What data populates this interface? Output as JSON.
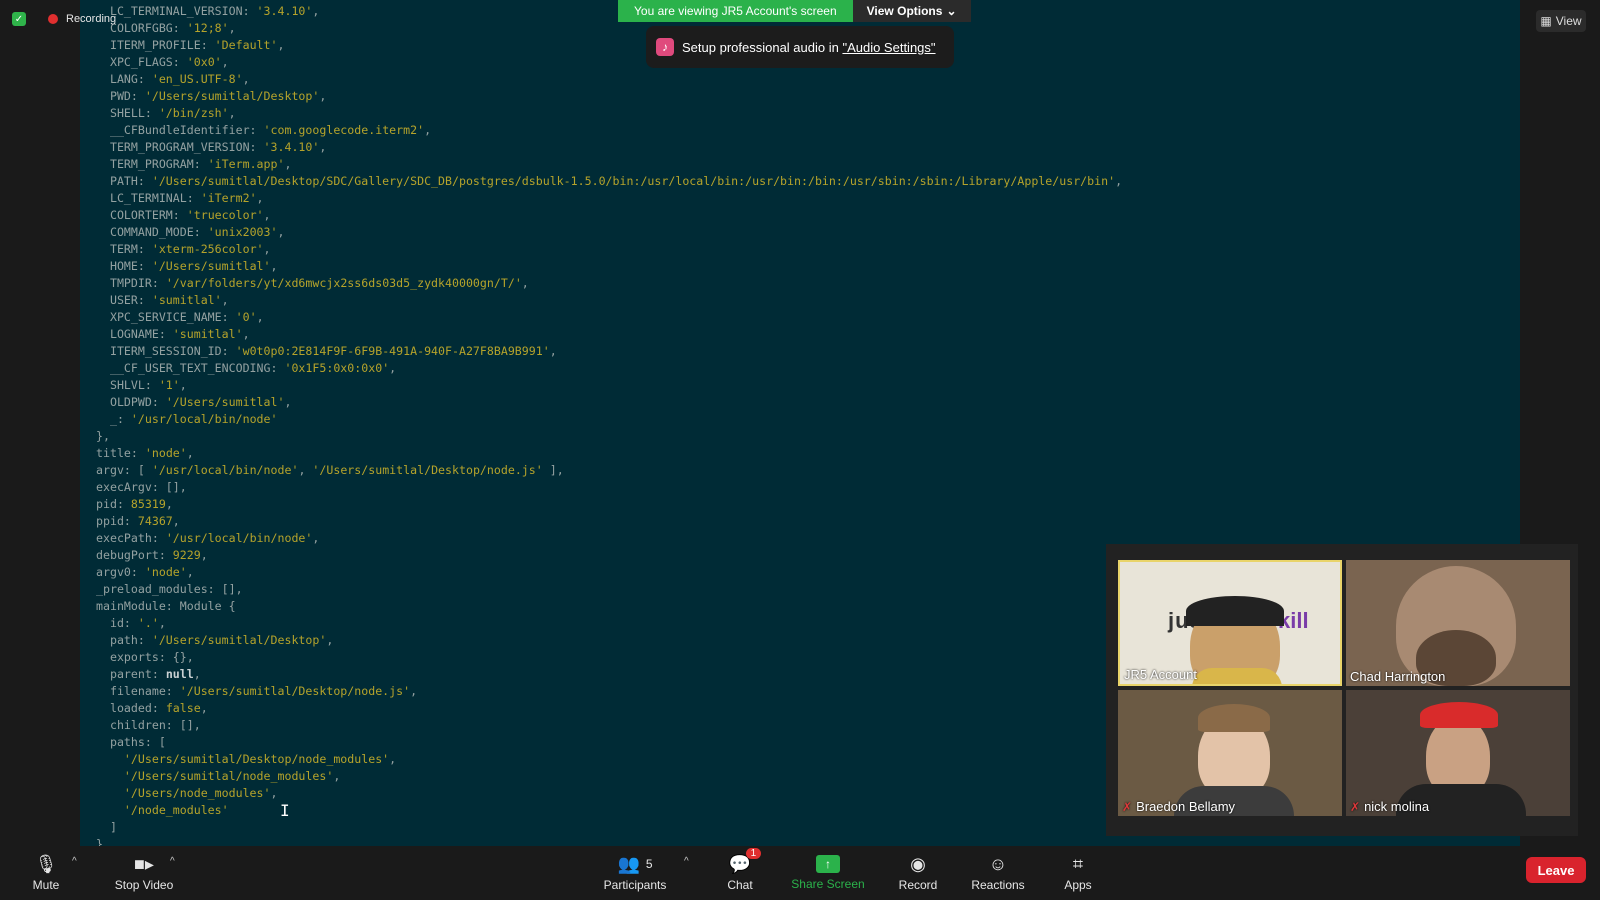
{
  "recording": {
    "label": "Recording"
  },
  "sharing": {
    "message": "You are viewing JR5 Account's screen",
    "options": "View Options"
  },
  "notification": {
    "text_prefix": "Setup professional audio in ",
    "link": "\"Audio Settings\""
  },
  "view_button": {
    "label": "View"
  },
  "terminal": {
    "lines": [
      [
        [
          "k",
          "  LC_TERMINAL_VERSION: "
        ],
        [
          "s",
          "'3.4.10'"
        ],
        [
          "k",
          ","
        ]
      ],
      [
        [
          "k",
          "  COLORFGBG: "
        ],
        [
          "s",
          "'12;8'"
        ],
        [
          "k",
          ","
        ]
      ],
      [
        [
          "k",
          "  ITERM_PROFILE: "
        ],
        [
          "s",
          "'Default'"
        ],
        [
          "k",
          ","
        ]
      ],
      [
        [
          "k",
          "  XPC_FLAGS: "
        ],
        [
          "s",
          "'0x0'"
        ],
        [
          "k",
          ","
        ]
      ],
      [
        [
          "k",
          "  LANG: "
        ],
        [
          "s",
          "'en_US.UTF-8'"
        ],
        [
          "k",
          ","
        ]
      ],
      [
        [
          "k",
          "  PWD: "
        ],
        [
          "s",
          "'/Users/sumitlal/Desktop'"
        ],
        [
          "k",
          ","
        ]
      ],
      [
        [
          "k",
          "  SHELL: "
        ],
        [
          "s",
          "'/bin/zsh'"
        ],
        [
          "k",
          ","
        ]
      ],
      [
        [
          "k",
          "  __CFBundleIdentifier: "
        ],
        [
          "s",
          "'com.googlecode.iterm2'"
        ],
        [
          "k",
          ","
        ]
      ],
      [
        [
          "k",
          "  TERM_PROGRAM_VERSION: "
        ],
        [
          "s",
          "'3.4.10'"
        ],
        [
          "k",
          ","
        ]
      ],
      [
        [
          "k",
          "  TERM_PROGRAM: "
        ],
        [
          "s",
          "'iTerm.app'"
        ],
        [
          "k",
          ","
        ]
      ],
      [
        [
          "k",
          "  PATH: "
        ],
        [
          "s",
          "'/Users/sumitlal/Desktop/SDC/Gallery/SDC_DB/postgres/dsbulk-1.5.0/bin:/usr/local/bin:/usr/bin:/bin:/usr/sbin:/sbin:/Library/Apple/usr/bin'"
        ],
        [
          "k",
          ","
        ]
      ],
      [
        [
          "k",
          "  LC_TERMINAL: "
        ],
        [
          "s",
          "'iTerm2'"
        ],
        [
          "k",
          ","
        ]
      ],
      [
        [
          "k",
          "  COLORTERM: "
        ],
        [
          "s",
          "'truecolor'"
        ],
        [
          "k",
          ","
        ]
      ],
      [
        [
          "k",
          "  COMMAND_MODE: "
        ],
        [
          "s",
          "'unix2003'"
        ],
        [
          "k",
          ","
        ]
      ],
      [
        [
          "k",
          "  TERM: "
        ],
        [
          "s",
          "'xterm-256color'"
        ],
        [
          "k",
          ","
        ]
      ],
      [
        [
          "k",
          "  HOME: "
        ],
        [
          "s",
          "'/Users/sumitlal'"
        ],
        [
          "k",
          ","
        ]
      ],
      [
        [
          "k",
          "  TMPDIR: "
        ],
        [
          "s",
          "'/var/folders/yt/xd6mwcjx2ss6ds03d5_zydk40000gn/T/'"
        ],
        [
          "k",
          ","
        ]
      ],
      [
        [
          "k",
          "  USER: "
        ],
        [
          "s",
          "'sumitlal'"
        ],
        [
          "k",
          ","
        ]
      ],
      [
        [
          "k",
          "  XPC_SERVICE_NAME: "
        ],
        [
          "s",
          "'0'"
        ],
        [
          "k",
          ","
        ]
      ],
      [
        [
          "k",
          "  LOGNAME: "
        ],
        [
          "s",
          "'sumitlal'"
        ],
        [
          "k",
          ","
        ]
      ],
      [
        [
          "k",
          "  ITERM_SESSION_ID: "
        ],
        [
          "s",
          "'w0t0p0:2E814F9F-6F9B-491A-940F-A27F8BA9B991'"
        ],
        [
          "k",
          ","
        ]
      ],
      [
        [
          "k",
          "  __CF_USER_TEXT_ENCODING: "
        ],
        [
          "s",
          "'0x1F5:0x0:0x0'"
        ],
        [
          "k",
          ","
        ]
      ],
      [
        [
          "k",
          "  SHLVL: "
        ],
        [
          "s",
          "'1'"
        ],
        [
          "k",
          ","
        ]
      ],
      [
        [
          "k",
          "  OLDPWD: "
        ],
        [
          "s",
          "'/Users/sumitlal'"
        ],
        [
          "k",
          ","
        ]
      ],
      [
        [
          "k",
          "  _: "
        ],
        [
          "s",
          "'/usr/local/bin/node'"
        ]
      ],
      [
        [
          "k",
          "},"
        ]
      ],
      [
        [
          "k",
          "title: "
        ],
        [
          "s",
          "'node'"
        ],
        [
          "k",
          ","
        ]
      ],
      [
        [
          "k",
          "argv: [ "
        ],
        [
          "s",
          "'/usr/local/bin/node'"
        ],
        [
          "k",
          ", "
        ],
        [
          "s",
          "'/Users/sumitlal/Desktop/node.js'"
        ],
        [
          "k",
          " ],"
        ]
      ],
      [
        [
          "k",
          "execArgv: [],"
        ]
      ],
      [
        [
          "k",
          "pid: "
        ],
        [
          "n",
          "85319"
        ],
        [
          "k",
          ","
        ]
      ],
      [
        [
          "k",
          "ppid: "
        ],
        [
          "n",
          "74367"
        ],
        [
          "k",
          ","
        ]
      ],
      [
        [
          "k",
          "execPath: "
        ],
        [
          "s",
          "'/usr/local/bin/node'"
        ],
        [
          "k",
          ","
        ]
      ],
      [
        [
          "k",
          "debugPort: "
        ],
        [
          "n",
          "9229"
        ],
        [
          "k",
          ","
        ]
      ],
      [
        [
          "k",
          "argv0: "
        ],
        [
          "s",
          "'node'"
        ],
        [
          "k",
          ","
        ]
      ],
      [
        [
          "k",
          "_preload_modules: [],"
        ]
      ],
      [
        [
          "k",
          "mainModule: Module {"
        ]
      ],
      [
        [
          "k",
          "  id: "
        ],
        [
          "s",
          "'.'"
        ],
        [
          "k",
          ","
        ]
      ],
      [
        [
          "k",
          "  path: "
        ],
        [
          "s",
          "'/Users/sumitlal/Desktop'"
        ],
        [
          "k",
          ","
        ]
      ],
      [
        [
          "k",
          "  exports: {},"
        ]
      ],
      [
        [
          "k",
          "  parent: "
        ],
        [
          "b",
          "null"
        ],
        [
          "k",
          ","
        ]
      ],
      [
        [
          "k",
          "  filename: "
        ],
        [
          "s",
          "'/Users/sumitlal/Desktop/node.js'"
        ],
        [
          "k",
          ","
        ]
      ],
      [
        [
          "k",
          "  loaded: "
        ],
        [
          "n",
          "false"
        ],
        [
          "k",
          ","
        ]
      ],
      [
        [
          "k",
          "  children: [],"
        ]
      ],
      [
        [
          "k",
          "  paths: ["
        ]
      ],
      [
        [
          "k",
          "    "
        ],
        [
          "s",
          "'/Users/sumitlal/Desktop/node_modules'"
        ],
        [
          "k",
          ","
        ]
      ],
      [
        [
          "k",
          "    "
        ],
        [
          "s",
          "'/Users/sumitlal/node_modules'"
        ],
        [
          "k",
          ","
        ]
      ],
      [
        [
          "k",
          "    "
        ],
        [
          "s",
          "'/Users/node_modules'"
        ],
        [
          "k",
          ","
        ]
      ],
      [
        [
          "k",
          "    "
        ],
        [
          "s",
          "'/node_modules'"
        ]
      ],
      [
        [
          "k",
          "  ]"
        ]
      ],
      [
        [
          "k",
          "}"
        ]
      ]
    ]
  },
  "participants": [
    {
      "name": "JR5 Account",
      "muted": false,
      "bg_text_left": "jus",
      "bg_text_right": "kill"
    },
    {
      "name": "Chad Harrington",
      "muted": false
    },
    {
      "name": "Braedon Bellamy",
      "muted": true
    },
    {
      "name": "nick molina",
      "muted": true
    }
  ],
  "toolbar": {
    "mute": "Mute",
    "stop_video": "Stop Video",
    "participants": "Participants",
    "participants_count": "5",
    "chat": "Chat",
    "chat_badge": "1",
    "share_screen": "Share Screen",
    "record": "Record",
    "reactions": "Reactions",
    "apps": "Apps",
    "leave": "Leave"
  },
  "colors": {
    "terminal_bg": "#002b36",
    "accent_green": "#2bb24b",
    "leave_red": "#d9232d"
  }
}
